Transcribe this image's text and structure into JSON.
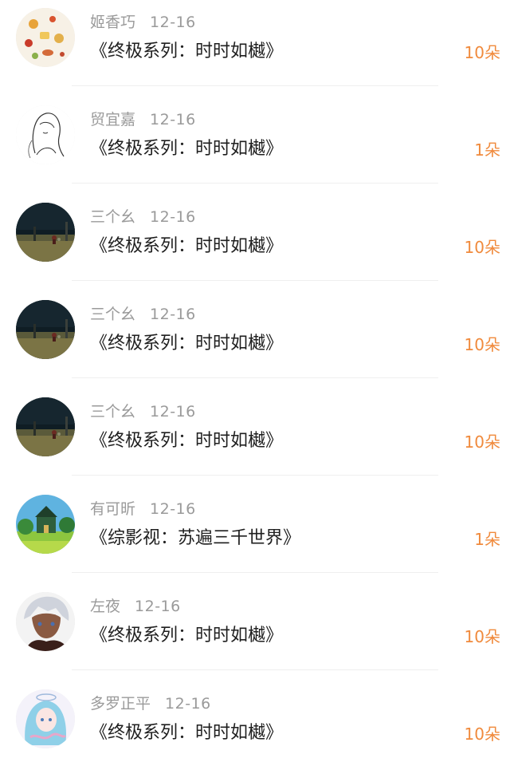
{
  "items": [
    {
      "user": "姬香巧",
      "date": "12-16",
      "title": "《终极系列：时时如樾》",
      "gift": "10朵",
      "avatar": "food-illustration"
    },
    {
      "user": "贸宜嘉",
      "date": "12-16",
      "title": "《终极系列：时时如樾》",
      "gift": "1朵",
      "avatar": "sketch-girl"
    },
    {
      "user": "三个幺",
      "date": "12-16",
      "title": "《终极系列：时时如樾》",
      "gift": "10朵",
      "avatar": "night-field"
    },
    {
      "user": "三个幺",
      "date": "12-16",
      "title": "《终极系列：时时如樾》",
      "gift": "10朵",
      "avatar": "night-field"
    },
    {
      "user": "三个幺",
      "date": "12-16",
      "title": "《终极系列：时时如樾》",
      "gift": "10朵",
      "avatar": "night-field"
    },
    {
      "user": "有可昕",
      "date": "12-16",
      "title": "《综影视：苏遍三千世界》",
      "gift": "1朵",
      "avatar": "green-house"
    },
    {
      "user": "左夜",
      "date": "12-16",
      "title": "《终极系列：时时如樾》",
      "gift": "10朵",
      "avatar": "anime-boy"
    },
    {
      "user": "多罗正平",
      "date": "12-16",
      "title": "《终极系列：时时如樾》",
      "gift": "10朵",
      "avatar": "anime-girl-blue"
    }
  ],
  "colors": {
    "gift_orange": "#f08a3c",
    "username_gray": "#9a9a9a",
    "title_black": "#1f1f1f",
    "divider": "#efefef"
  }
}
